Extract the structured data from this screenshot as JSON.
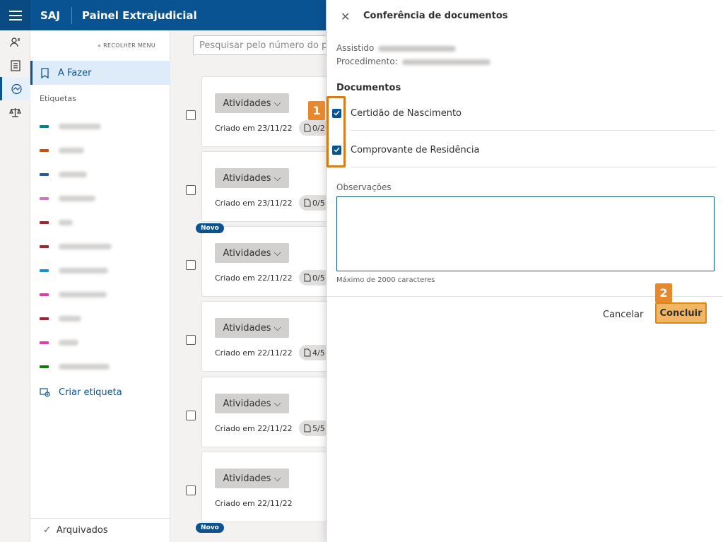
{
  "header": {
    "brand": "SAJ",
    "title": "Painel Extrajudicial"
  },
  "rail": {
    "icons": [
      "people-icon",
      "list-icon",
      "handshake-icon",
      "scales-icon"
    ]
  },
  "menu": {
    "collapse_label": "RECOLHER MENU",
    "todo_label": "A Fazer",
    "tags_heading": "Etiquetas",
    "tags": [
      {
        "color": "#038387"
      },
      {
        "color": "#ca5010"
      },
      {
        "color": "#2b579a"
      },
      {
        "color": "#c77cbd"
      },
      {
        "color": "#a4262c"
      },
      {
        "color": "#a4262c"
      },
      {
        "color": "#1b8fd6"
      },
      {
        "color": "#e43ba6"
      },
      {
        "color": "#a4262c"
      },
      {
        "color": "#e43ba6"
      },
      {
        "color": "#107c10"
      }
    ],
    "create_tag_label": "Criar etiqueta",
    "archived_label": "Arquivados"
  },
  "search": {
    "placeholder": "Pesquisar pelo número do processo"
  },
  "cards": [
    {
      "button": "Atividades",
      "created": "Criado em 23/11/22",
      "count": "0/2",
      "novo": false
    },
    {
      "button": "Atividades",
      "created": "Criado em 23/11/22",
      "count": "0/5",
      "novo": false
    },
    {
      "button": "Atividades",
      "created": "Criado em 22/11/22",
      "count": "0/5",
      "novo": true
    },
    {
      "button": "Atividades",
      "created": "Criado em 22/11/22",
      "count": "4/5",
      "novo": false
    },
    {
      "button": "Atividades",
      "created": "Criado em 22/11/22",
      "count": "5/5",
      "novo": false
    },
    {
      "button": "Atividades",
      "created": "Criado em 22/11/22",
      "count": "",
      "novo": false
    }
  ],
  "novo_label": "Novo",
  "dialog": {
    "title": "Conferência de documentos",
    "assistido_label": "Assistido",
    "procedimento_label": "Procedimento:",
    "docs_heading": "Documentos",
    "docs": [
      {
        "label": "Certidão de Nascimento",
        "checked": true
      },
      {
        "label": "Comprovante de Residência",
        "checked": true
      }
    ],
    "obs_label": "Observações",
    "obs_value": "",
    "hint": "Máximo de 2000 caracteres",
    "cancel_label": "Cancelar",
    "ok_label": "Concluir"
  },
  "annotations": {
    "one": "1",
    "two": "2",
    "color": "#e6882b"
  }
}
